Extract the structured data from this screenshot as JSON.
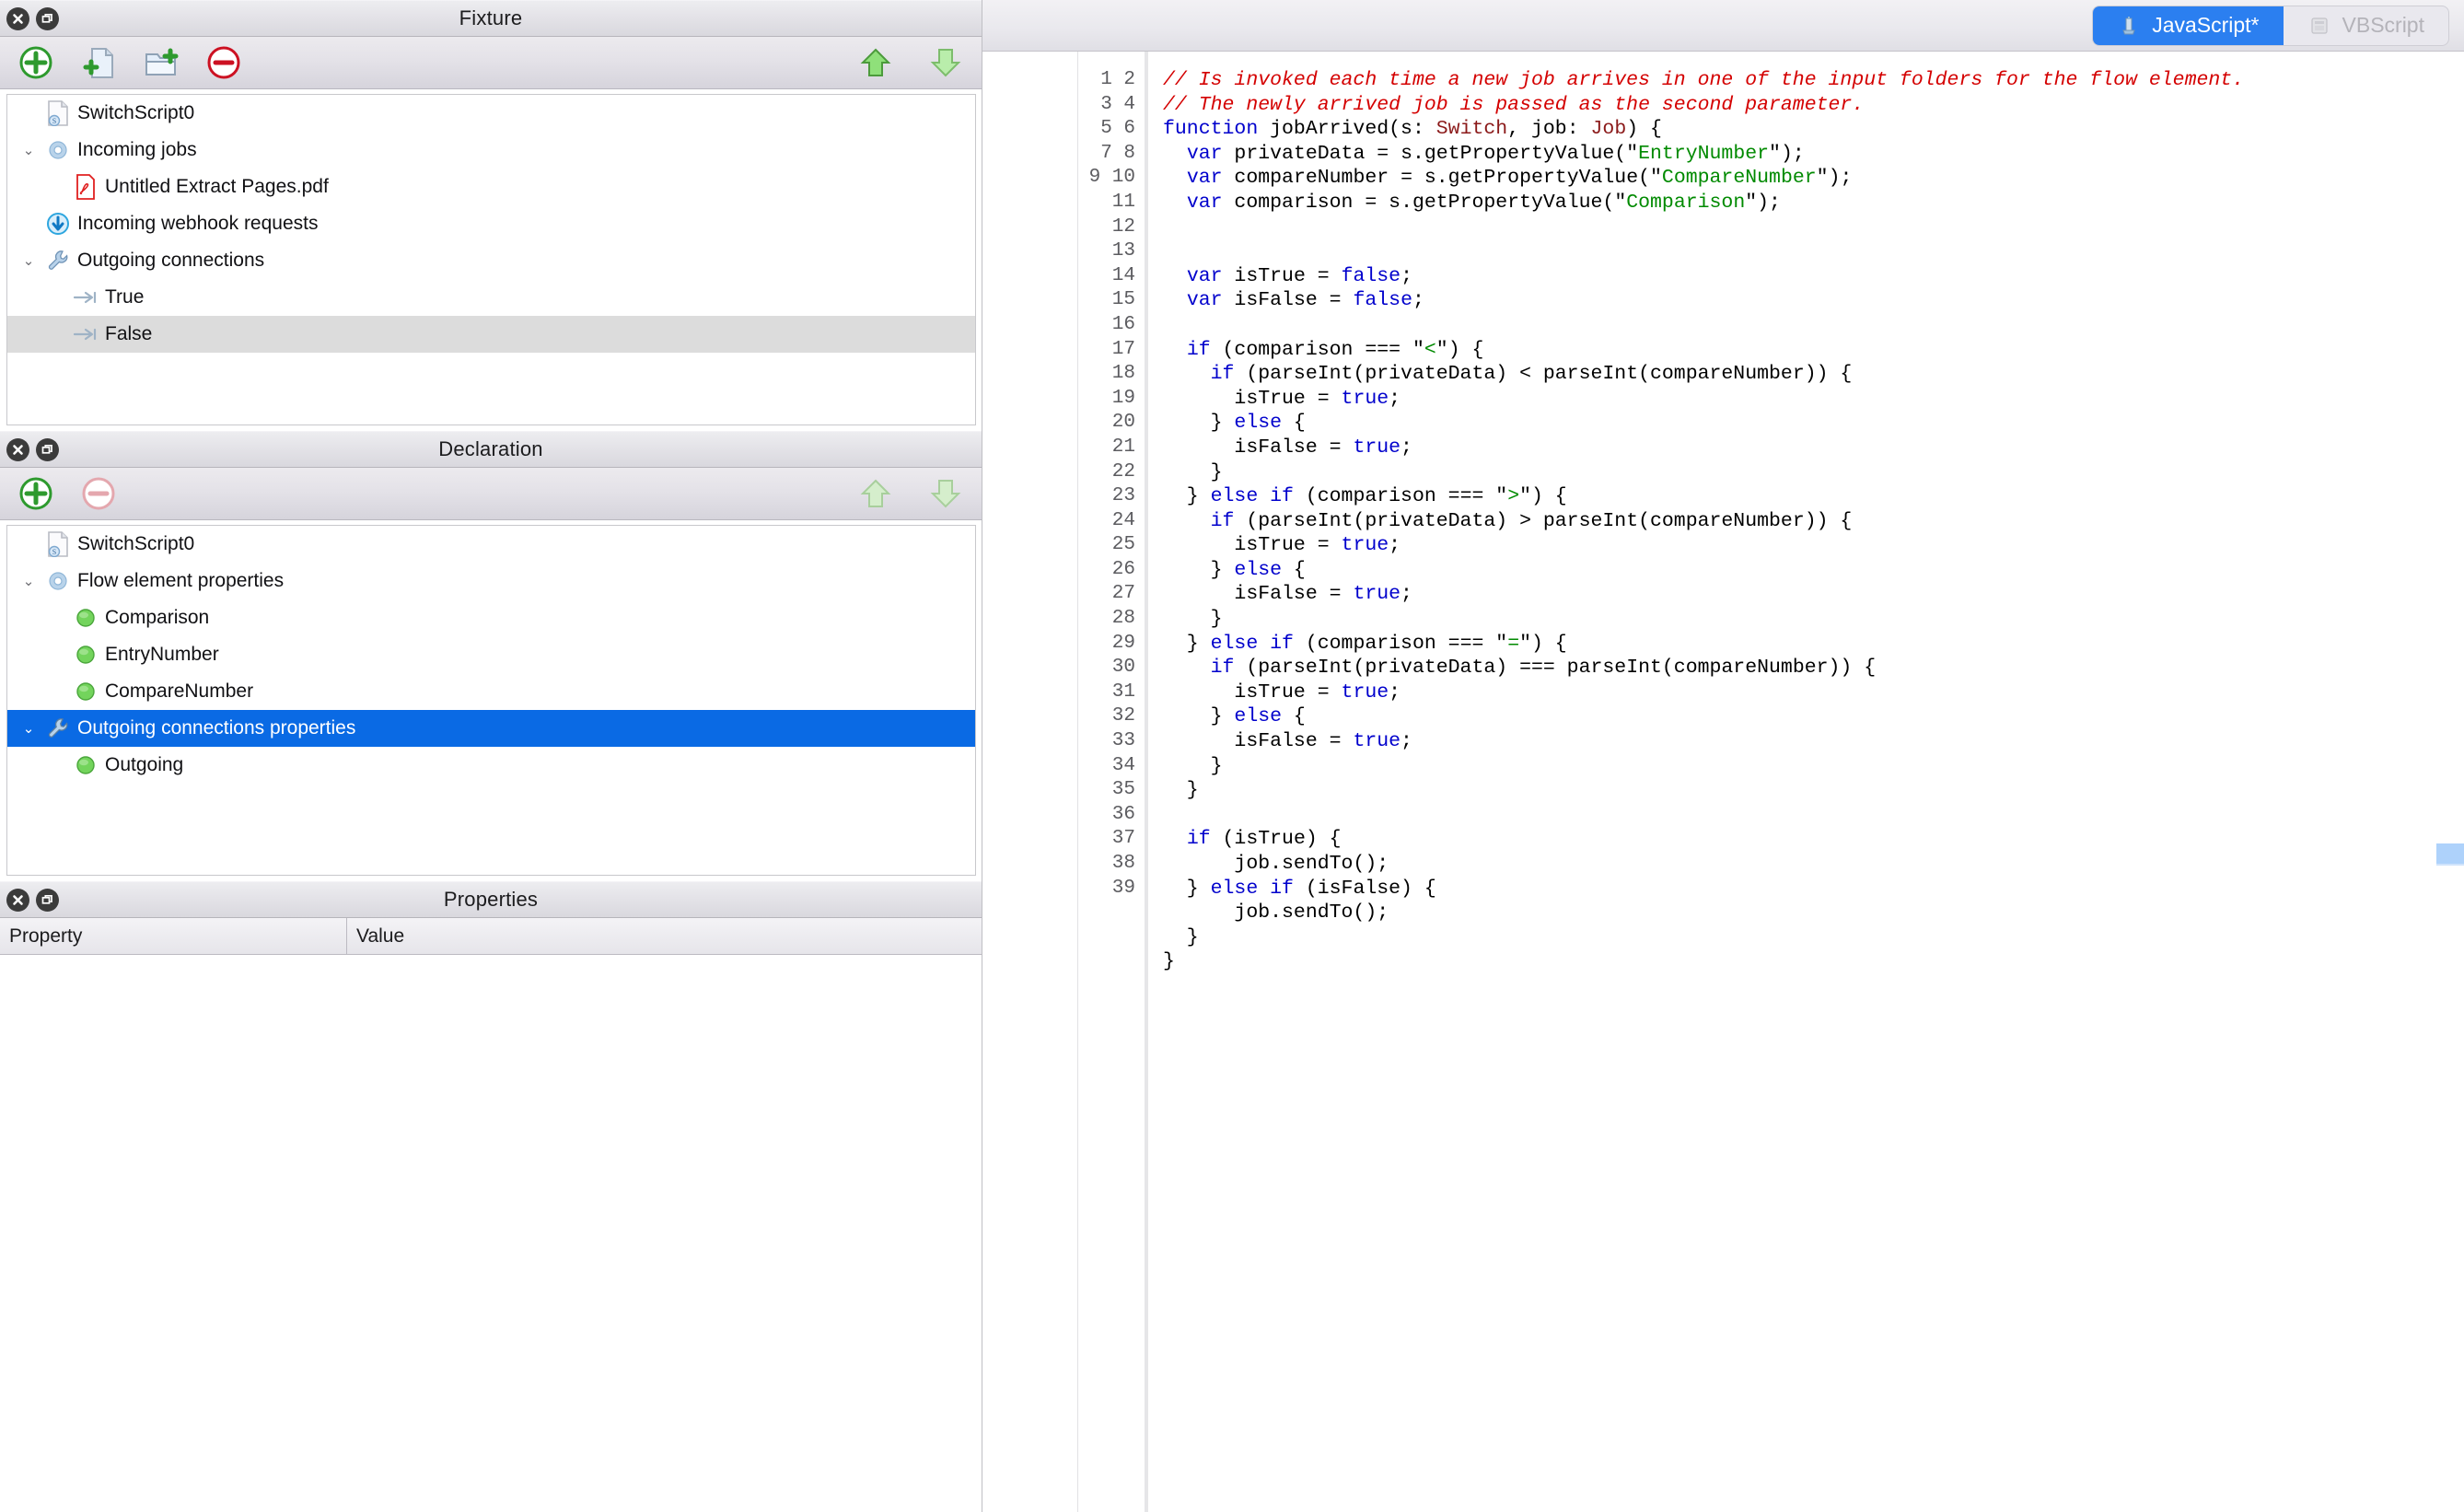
{
  "panels": {
    "fixture": {
      "title": "Fixture",
      "window_buttons": [
        {
          "name": "close-icon",
          "glyph": "✕"
        },
        {
          "name": "restore-icon",
          "glyph": "❐"
        }
      ],
      "toolbar": {
        "left_icons": [
          {
            "name": "add-icon",
            "label": "Add"
          },
          {
            "name": "add-file-icon",
            "label": "Add file"
          },
          {
            "name": "add-folder-icon",
            "label": "Add folder"
          },
          {
            "name": "remove-icon",
            "label": "Remove"
          }
        ],
        "right_icons": [
          {
            "name": "move-up-icon",
            "label": "Move up"
          },
          {
            "name": "move-down-icon",
            "label": "Move down"
          }
        ]
      },
      "tree": [
        {
          "label": "SwitchScript0",
          "icon": "script-file-icon",
          "indent": 1,
          "twisty": "",
          "state": "normal"
        },
        {
          "label": "Incoming jobs",
          "icon": "gear-icon",
          "indent": 1,
          "twisty": "⌄",
          "state": "normal"
        },
        {
          "label": "Untitled Extract Pages.pdf",
          "icon": "pdf-file-icon",
          "indent": 2,
          "twisty": "",
          "state": "normal"
        },
        {
          "label": "Incoming webhook requests",
          "icon": "webhook-download-icon",
          "indent": 1,
          "twisty": "",
          "state": "normal"
        },
        {
          "label": "Outgoing connections",
          "icon": "wrench-icon",
          "indent": 1,
          "twisty": "⌄",
          "state": "normal"
        },
        {
          "label": "True",
          "icon": "connection-arrow-icon",
          "indent": 2,
          "twisty": "",
          "state": "normal"
        },
        {
          "label": "False",
          "icon": "connection-arrow-icon",
          "indent": 2,
          "twisty": "",
          "state": "highlighted"
        }
      ]
    },
    "declaration": {
      "title": "Declaration",
      "window_buttons": [
        {
          "name": "close-icon",
          "glyph": "✕"
        },
        {
          "name": "restore-icon",
          "glyph": "❐"
        }
      ],
      "toolbar": {
        "left_icons": [
          {
            "name": "add-icon",
            "label": "Add"
          },
          {
            "name": "remove-icon-disabled",
            "label": "Remove"
          }
        ],
        "right_icons": [
          {
            "name": "move-up-icon-disabled",
            "label": "Move up"
          },
          {
            "name": "move-down-icon-disabled",
            "label": "Move down"
          }
        ]
      },
      "tree": [
        {
          "label": "SwitchScript0",
          "icon": "script-file-icon",
          "indent": 1,
          "twisty": "",
          "state": "normal"
        },
        {
          "label": "Flow element properties",
          "icon": "gear-icon",
          "indent": 1,
          "twisty": "⌄",
          "state": "normal"
        },
        {
          "label": "Comparison",
          "icon": "green-bullet-icon",
          "indent": 2,
          "twisty": "",
          "state": "normal"
        },
        {
          "label": "EntryNumber",
          "icon": "green-bullet-icon",
          "indent": 2,
          "twisty": "",
          "state": "normal"
        },
        {
          "label": "CompareNumber",
          "icon": "green-bullet-icon",
          "indent": 2,
          "twisty": "",
          "state": "normal"
        },
        {
          "label": "Outgoing connections properties",
          "icon": "wrench-icon",
          "indent": 1,
          "twisty": "⌄",
          "state": "selected"
        },
        {
          "label": "Outgoing",
          "icon": "green-bullet-icon",
          "indent": 2,
          "twisty": "",
          "state": "normal"
        }
      ]
    },
    "properties": {
      "title": "Properties",
      "window_buttons": [
        {
          "name": "close-icon",
          "glyph": "✕"
        },
        {
          "name": "restore-icon",
          "glyph": "❐"
        }
      ],
      "columns": [
        "Property",
        "Value"
      ],
      "rows": []
    }
  },
  "editor": {
    "tabs": [
      {
        "label": "JavaScript*",
        "icon": "javascript-icon",
        "active": true
      },
      {
        "label": "VBScript",
        "icon": "vbscript-icon",
        "active": false
      }
    ],
    "active_tab": "JavaScript*",
    "line_numbers": "1\n2\n3\n4\n5\n6\n7\n8\n9\n10\n11\n12\n13\n14\n15\n16\n17\n18\n19\n20\n21\n22\n23\n24\n25\n26\n27\n28\n29\n30\n31\n32\n33\n34\n35\n36\n37\n38\n39",
    "total_lines": 39,
    "language": "JavaScript",
    "code_lines": [
      "// Is invoked each time a new job arrives in one of the input folders for the flow element.",
      "// The newly arrived job is passed as the second parameter.",
      "function jobArrived(s: Switch, job: Job) {",
      "  var privateData = s.getPropertyValue(\"EntryNumber\");",
      "  var compareNumber = s.getPropertyValue(\"CompareNumber\");",
      "  var comparison = s.getPropertyValue(\"Comparison\");",
      "",
      "",
      "  var isTrue = false;",
      "  var isFalse = false;",
      "",
      "  if (comparison === \"<\") {",
      "    if (parseInt(privateData) < parseInt(compareNumber)) {",
      "      isTrue = true;",
      "    } else {",
      "      isFalse = true;",
      "    }",
      "  } else if (comparison === \">\") {",
      "    if (parseInt(privateData) > parseInt(compareNumber)) {",
      "      isTrue = true;",
      "    } else {",
      "      isFalse = true;",
      "    }",
      "  } else if (comparison === \"=\") {",
      "    if (parseInt(privateData) === parseInt(compareNumber)) {",
      "      isTrue = true;",
      "    } else {",
      "      isFalse = true;",
      "    }",
      "  }",
      "",
      "  if (isTrue) {",
      "      job.sendTo();",
      "  } else if (isFalse) {",
      "      job.sendTo();",
      "  }",
      "}",
      "",
      ""
    ]
  },
  "colors": {
    "selection_blue": "#0a6ae4",
    "tab_active_blue": "#2b7ff0",
    "comment_red": "#d40000",
    "keyword_blue": "#0000cc",
    "string_green": "#008a00",
    "type_darkred": "#8b1a1a",
    "row_highlight_gray": "#dcdcdc",
    "scroll_marker_blue": "#aed2fb"
  }
}
